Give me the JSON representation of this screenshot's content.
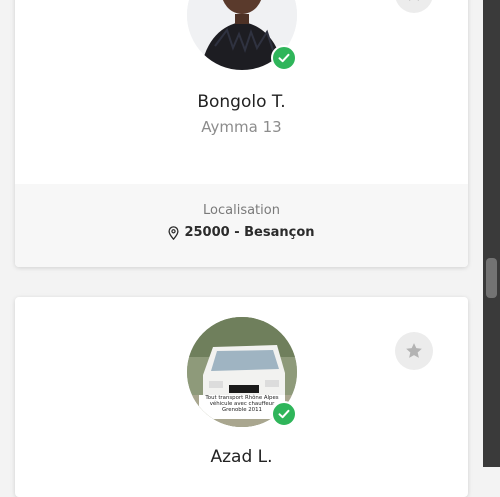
{
  "cards": [
    {
      "name": "Bongolo T.",
      "company": "Aymma 13",
      "location_label": "Localisation",
      "location_value": "25000 - Besançon",
      "verified": true
    },
    {
      "name": "Azad L.",
      "photo_caption": "Tout transport Rhône Alpes véhicule avec chauffeur Grenoble 2011",
      "verified": true
    }
  ],
  "icons": {
    "verified": "check-icon",
    "favorite": "star-icon",
    "location": "map-pin-icon"
  },
  "colors": {
    "verified_badge": "#2fb55a",
    "favorite_button": "#ececec",
    "star": "#b3b3b3",
    "footer_bg": "#f7f7f7"
  }
}
